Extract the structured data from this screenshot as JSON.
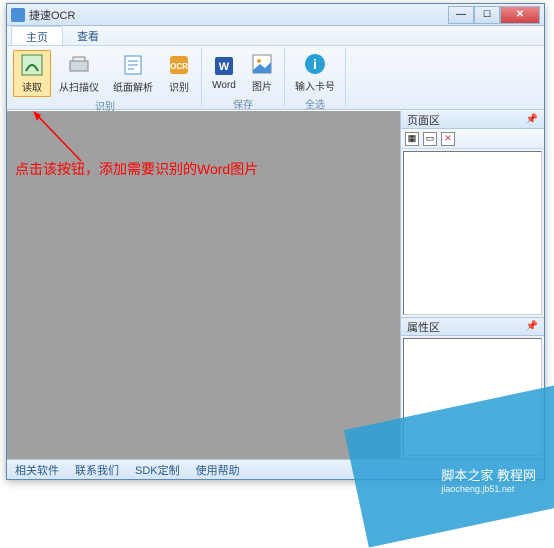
{
  "titlebar": {
    "title": "捷速OCR"
  },
  "menubar": {
    "tabs": [
      {
        "label": "主页",
        "active": true
      },
      {
        "label": "查看",
        "active": false
      }
    ]
  },
  "ribbon": {
    "groups": [
      {
        "name": "识别",
        "items": [
          {
            "label": "读取",
            "icon": "read-icon",
            "highlighted": true
          },
          {
            "label": "从扫描仪",
            "icon": "scanner-icon"
          },
          {
            "label": "纸面解析",
            "icon": "paper-parse-icon"
          },
          {
            "label": "识别",
            "icon": "ocr-icon"
          }
        ]
      },
      {
        "name": "保存",
        "items": [
          {
            "label": "Word",
            "icon": "word-icon"
          },
          {
            "label": "图片",
            "icon": "image-icon"
          }
        ]
      },
      {
        "name": "全选",
        "items": [
          {
            "label": "输入卡号",
            "icon": "info-icon"
          }
        ]
      }
    ]
  },
  "annotation": {
    "text": "点击该按钮，添加需要识别的Word图片"
  },
  "right_panel": {
    "panel1": {
      "title": "页面区"
    },
    "panel2": {
      "title": "属性区"
    }
  },
  "statusbar": {
    "items": [
      "相关软件",
      "联系我们",
      "SDK定制",
      "使用帮助"
    ]
  },
  "watermark": {
    "main": "脚本之家 教程网",
    "sub": "jiaocheng.jb51.net"
  }
}
